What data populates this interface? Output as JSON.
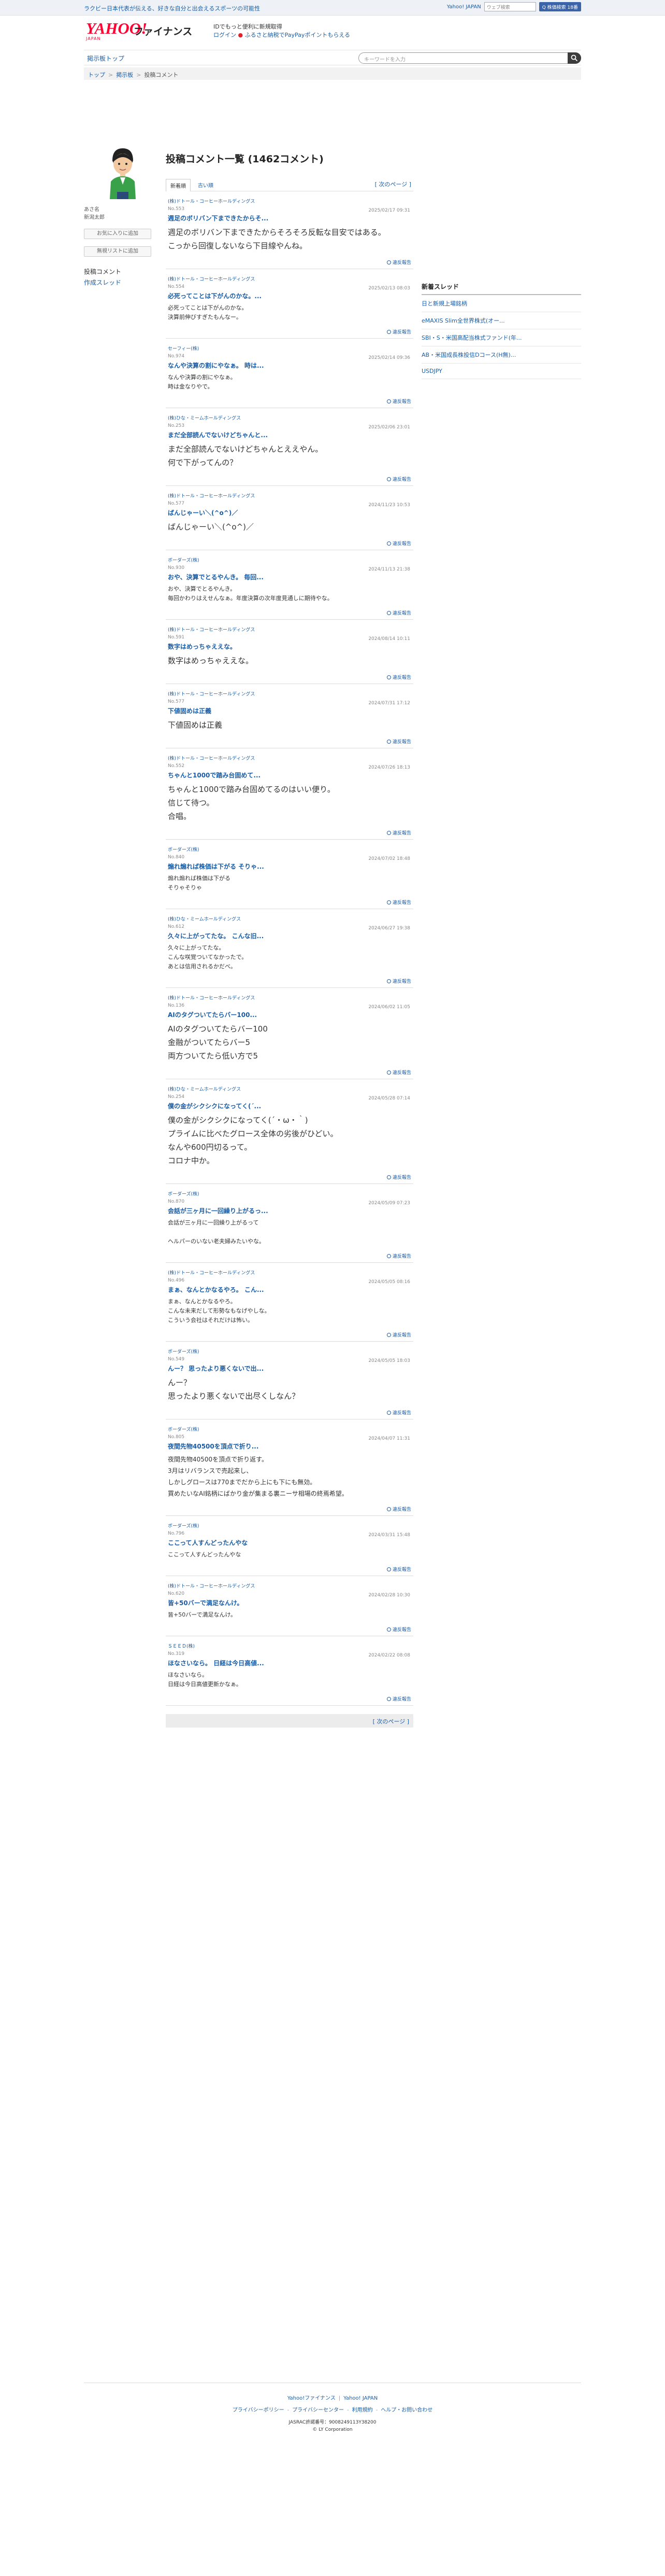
{
  "topbar": {
    "promo": "ラクビー日本代表が伝える、好きな自分と出会えるスポーツの可能性",
    "yahoo_japan_link": "Yahoo! JAPAN",
    "search_placeholder": "ウェブ検索",
    "search_button": "Q 株価検索 18番"
  },
  "header": {
    "logo_text": "YAHOO!",
    "logo_sub": "JAPAN",
    "service": "ファイナンス",
    "msg_line1": "IDでもっと便利に新規取得",
    "login": "ログイン",
    "msg_line2": "ふるさと納税でPayPayポイントもらえる"
  },
  "nav": {
    "tab": "掲示板トップ",
    "search_placeholder": "キーワードを入力"
  },
  "breadcrumb": [
    "トップ",
    "掲示板",
    "投稿コメント"
  ],
  "user": {
    "label": "あさ名",
    "name": "新潟太郎",
    "fav_button": "お気に入りに追加",
    "ignore_button": "無視リストに追加",
    "nav_comments": "投稿コメント",
    "nav_threads": "作成スレッド"
  },
  "main": {
    "title": "投稿コメント一覧 (1462コメント)",
    "sort_new": "新着順",
    "sort_old": "古い順",
    "next_page": "[ 次のページ ]",
    "report_label": "違反報告"
  },
  "posts": [
    {
      "company": "(株)ドトール・コーヒーホールディングス",
      "no": "No.553",
      "date": "2025/02/17 09:31",
      "title": "週足のボリバン下まできたからそ...",
      "body": "週足のボリバン下まできたからそろそろ反転な目安ではある。\nこっから回復しないなら下目線やんね。",
      "size": "l"
    },
    {
      "company": "(株)ドトール・コーヒーホールディングス",
      "no": "No.554",
      "date": "2025/02/13 08:03",
      "title": "必死ってことは下がんのかな。...",
      "body": "必死ってことは下がんのかな。\n決算前伸びすぎたもんなー。",
      "size": "s"
    },
    {
      "company": "セーフィー(株)",
      "no": "No.974",
      "date": "2025/02/14 09:36",
      "title": "なんや決算の割にやなぁ。 時は...",
      "body": "なんや決算の割にやなぁ。\n時は金なりやで。",
      "size": "s"
    },
    {
      "company": "(株)ひな・ミームホールディングス",
      "no": "No.253",
      "date": "2025/02/06 23:01",
      "title": "まだ全部読んでないけどちゃんと...",
      "body": "まだ全部読んでないけどちゃんとええやん。\n何で下がってんの？",
      "size": "l"
    },
    {
      "company": "(株)ドトール・コーヒーホールディングス",
      "no": "No.577",
      "date": "2024/11/23 10:53",
      "title": "ばんじゃーい＼(^o^)／",
      "body": "ばんじゃーい＼(^o^)／",
      "size": "l"
    },
    {
      "company": "ボーダーズ(株)",
      "no": "No.930",
      "date": "2024/11/13 21:38",
      "title": "おや、決算でとるやんき。 毎回...",
      "body": "おや、決算でとるやんき。\n毎回かわりはえせんなぁ。年度決算の次年度見通しに期待やな。",
      "size": "s"
    },
    {
      "company": "(株)ドトール・コーヒーホールディングス",
      "no": "No.591",
      "date": "2024/08/14 10:11",
      "title": "数字はめっちゃええな。",
      "body": "数字はめっちゃええな。",
      "size": "l"
    },
    {
      "company": "(株)ドトール・コーヒーホールディングス",
      "no": "No.577",
      "date": "2024/07/31 17:12",
      "title": "下値固めは正義",
      "body": "下値固めは正義",
      "size": "l"
    },
    {
      "company": "(株)ドトール・コーヒーホールディングス",
      "no": "No.552",
      "date": "2024/07/26 18:13",
      "title": "ちゃんと1000で踏み台固めて...",
      "body": "ちゃんと1000で踏み台固めてるのはいい便り。\n信じて待つ。\n合唱。",
      "size": "l"
    },
    {
      "company": "ボーダーズ(株)",
      "no": "No.840",
      "date": "2024/07/02 18:48",
      "title": "煽れ煽れば株価は下がる そりゃ...",
      "body": "煽れ煽れば株価は下がる\nそりゃそりゃ",
      "size": "s"
    },
    {
      "company": "(株)ひな・ミームホールディングス",
      "no": "No.612",
      "date": "2024/06/27 19:38",
      "title": "久々に上がってたな。 こんな旧...",
      "body": "久々に上がってたな。\nこんな咲覚ついてなかったで。\nあとは信用されるかだべ。",
      "size": "s"
    },
    {
      "company": "(株)ドトール・コーヒーホールディングス",
      "no": "No.136",
      "date": "2024/06/02 11:05",
      "title": "AIのタグついてたらバー100...",
      "body": "AIのタグついてたらバー100\n金融がついてたらバー5\n両方ついてたら低い方で5",
      "size": "l"
    },
    {
      "company": "(株)ひな・ミームホールディングス",
      "no": "No.254",
      "date": "2024/05/28 07:14",
      "title": "僕の金がシクシクになってく(´...",
      "body": "僕の金がシクシクになってく(´・ω・｀)\nプライムに比べたグロース全体の劣後がひどい。\nなんや600円切るって。\nコロナ中か。",
      "size": "l"
    },
    {
      "company": "ボーダーズ(株)",
      "no": "No.870",
      "date": "2024/05/09 07:23",
      "title": "会話が三ヶ月に一回繰り上がるっ...",
      "body": "会話が三ヶ月に一回繰り上がるって\n\nヘルパーのいない老夫婦みたいやな。",
      "size": "s"
    },
    {
      "company": "(株)ドトール・コーヒーホールディングス",
      "no": "No.496",
      "date": "2024/05/05 08:16",
      "title": "まぁ、なんとかなるやろ。 こん...",
      "body": "まぁ、なんとかなるやろ。\nこんな未来だして形勢なもなげやしな。\nこういう会社はそれだけは怖い。",
      "size": "s"
    },
    {
      "company": "ボーダーズ(株)",
      "no": "No.549",
      "date": "2024/05/05 18:03",
      "title": "んー？ 思ったより悪くないで出...",
      "body": "んー？\n思ったより悪くないで出尽くしなん？",
      "size": "l"
    },
    {
      "company": "ボーダーズ(株)",
      "no": "No.805",
      "date": "2024/04/07 11:31",
      "title": "夜間先物40500を頂点で折り...",
      "body": "夜間先物40500を頂点で折り返す。\n3月はリバランスで売起来し、\nしかしグロースは770までだから上にも下にも無効。\n買めたいなAI銘柄にばかり金が集まる裏ニーサ相場の終焉希望。",
      "size": "s2"
    },
    {
      "company": "ボーダーズ(株)",
      "no": "No.796",
      "date": "2024/03/31 15:48",
      "title": "ここって人すんどったんやな",
      "body": "ここって人すんどったんやな",
      "size": "s"
    },
    {
      "company": "(株)ドトール・コーヒーホールディングス",
      "no": "No.620",
      "date": "2024/02/28 10:30",
      "title": "皆+50バーで満足なんけ。",
      "body": "皆+50バーで満足なんけ。",
      "size": "s"
    },
    {
      "company": "ＳＥＥＤ(株)",
      "no": "No.319",
      "date": "2024/02/22 08:08",
      "title": "ほなさいなら。 日経は今日高値...",
      "body": "ほなさいなら。\n日経は今日高値更新かなぁ。",
      "size": "s"
    }
  ],
  "sidebar": {
    "title": "新着スレッド",
    "threads": [
      "日と新規上場銘柄",
      "eMAXIS Slim全世界株式(オー...",
      "SBI・S・米国高配当株式ファンド(年...",
      "AB・米国成長株投信Dコース(H無)...",
      "USDJPY"
    ]
  },
  "footer": {
    "links1": [
      "Yahoo!ファイナンス",
      "Yahoo! JAPAN"
    ],
    "links2": [
      "プライバシーポリシー",
      "プライバシーセンター",
      "利用規約",
      "ヘルプ・お問い合わせ"
    ],
    "jasrac": "JASRAC許諾番号：9008249113Y38200",
    "copyright": "© LY Corporation"
  },
  "colors": {
    "link": "#1a5da6",
    "logo": "#ff0033",
    "background": "#ffffff"
  },
  "icons": [
    "search-icon",
    "avatar-icon",
    "report-icon",
    "paypay-icon"
  ]
}
